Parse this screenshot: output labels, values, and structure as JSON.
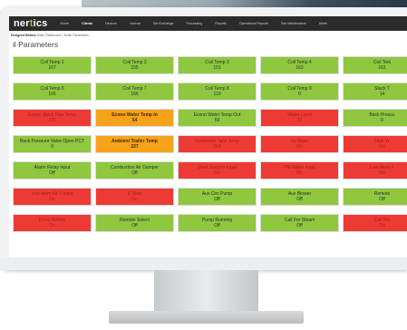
{
  "app": {
    "logo_text": "ner",
    "logo_accent": "t",
    "logo_suffix": "ics"
  },
  "nav": {
    "items": [
      "Home",
      "Clients",
      "Devices",
      "Licence",
      "Bin Exchange",
      "Processing",
      "Reports",
      "Operational Reports",
      "Site Maintenance",
      "Alerts"
    ],
    "active_index": 1
  },
  "breadcrumb": {
    "prefix": "Designed Boilers",
    "path": "Boiler Dashboard > Boiler Parameters"
  },
  "page": {
    "title": "il Parameters"
  },
  "colors": {
    "green": "#8fc73e",
    "red": "#ee3a35",
    "orange": "#f7a21b",
    "navbar": "#2b2b2b"
  },
  "tiles": [
    [
      {
        "label": "Coil Temp 1",
        "value": "167",
        "status": "green"
      },
      {
        "label": "Coil Temp 2",
        "value": "155",
        "status": "green"
      },
      {
        "label": "Coil Temp 3",
        "value": "151",
        "status": "green"
      },
      {
        "label": "Coil Temp 4",
        "value": "163",
        "status": "green"
      },
      {
        "label": "Coil Tem",
        "value": "161",
        "status": "green"
      }
    ],
    [
      {
        "label": "Coil Temp 6",
        "value": "165",
        "status": "green"
      },
      {
        "label": "Coil Temp 7",
        "value": "166",
        "status": "green"
      },
      {
        "label": "Coil Temp 8",
        "value": "119",
        "status": "green"
      },
      {
        "label": "Coil Temp 9",
        "value": "0",
        "status": "green"
      },
      {
        "label": "Stack T",
        "value": "14",
        "status": "green"
      }
    ],
    [
      {
        "label": "Econo Stack Flue Temp",
        "value": "155",
        "status": "red"
      },
      {
        "label": "Econo Water Temp In",
        "value": "54",
        "status": "orange"
      },
      {
        "label": "Econo Water Temp Out",
        "value": "59",
        "status": "green"
      },
      {
        "label": "Water Level",
        "value": "22",
        "status": "red"
      },
      {
        "label": "Back Pressu",
        "value": "0",
        "status": "green"
      }
    ],
    [
      {
        "label": "Back Pressure Valve Open PCT",
        "value": "0",
        "status": "green"
      },
      {
        "label": "Ambient Trailer Temp",
        "value": "227",
        "status": "orange"
      },
      {
        "label": "Feedwater Tank Temp",
        "value": "264",
        "status": "red"
      },
      {
        "label": "Lo Water",
        "value": "On",
        "status": "red"
      },
      {
        "label": "High W",
        "value": "On",
        "status": "red"
      }
    ],
    [
      {
        "label": "Alarm Relay Input",
        "value": "Off",
        "status": "green"
      },
      {
        "label": "Combustion Air Damper",
        "value": "Off",
        "status": "green"
      },
      {
        "label": "Shell Damper Input",
        "value": "On",
        "status": "red"
      },
      {
        "label": "PM Water Input",
        "value": "On",
        "status": "red"
      },
      {
        "label": "Low Atom P",
        "value": "On",
        "status": "red"
      }
    ],
    [
      {
        "label": "Low Atom Air 2 Input",
        "value": "On",
        "status": "red"
      },
      {
        "label": "E Stop",
        "value": "On",
        "status": "red"
      },
      {
        "label": "Aux Circ Pump",
        "value": "Off",
        "status": "green"
      },
      {
        "label": "Aux Blower",
        "value": "Off",
        "status": "green"
      },
      {
        "label": "Remote",
        "value": "Off",
        "status": "green"
      }
    ],
    [
      {
        "label": "Circul Reflow",
        "value": "On",
        "status": "red"
      },
      {
        "label": "Remote Select",
        "value": "Off",
        "status": "green"
      },
      {
        "label": "Pump Running",
        "value": "Off",
        "status": "green"
      },
      {
        "label": "Call For Steam",
        "value": "Off",
        "status": "green"
      },
      {
        "label": "Call For",
        "value": "On",
        "status": "red"
      }
    ]
  ]
}
